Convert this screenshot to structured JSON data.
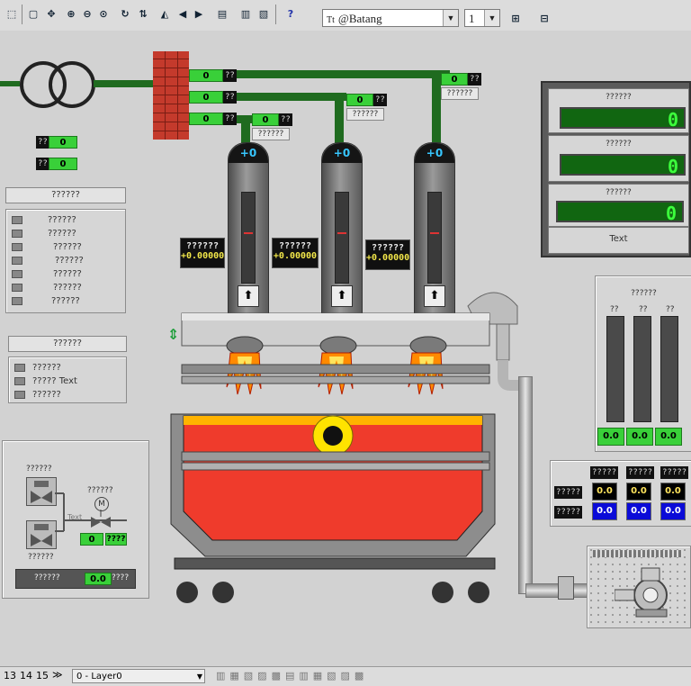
{
  "toolbar": {
    "font_name": "@Batang",
    "font_size": "1",
    "font_glyph": "Tt"
  },
  "transformer": {
    "label": ""
  },
  "pipes": {
    "top_values": [
      "0",
      "0",
      "0"
    ],
    "units": "??",
    "burner_values": [
      "0",
      "0",
      "0"
    ],
    "burner_labels": [
      "??????",
      "??????",
      "??????"
    ]
  },
  "left_small": [
    {
      "unit": "??",
      "value": "0"
    },
    {
      "unit": "??",
      "value": "0"
    }
  ],
  "list_panel": {
    "title": "??????",
    "items": [
      "??????",
      "??????",
      "??????",
      "??????",
      "??????",
      "??????",
      "??????"
    ]
  },
  "mode_panel": {
    "title": "??????",
    "items": [
      "??????",
      "?????  Text",
      "??????"
    ]
  },
  "burners": [
    {
      "top": "+0",
      "label": "??????",
      "value": "+0.00000"
    },
    {
      "top": "+0",
      "label": "??????",
      "value": "+0.00000"
    },
    {
      "top": "+0",
      "label": "??????",
      "value": "+0.00000"
    }
  ],
  "valve_panel": {
    "top_label": "??????",
    "mid_label": "??????",
    "motor": "M",
    "bottom_label": "??????",
    "text_label": "Text",
    "value": "0",
    "unit": "????",
    "footer_label": "??????",
    "footer_value": "0.0",
    "footer_unit": "????"
  },
  "lcd_panel": {
    "rows": [
      {
        "label": "??????",
        "value": "0"
      },
      {
        "label": "??????",
        "value": "0"
      },
      {
        "label": "??????",
        "value": "0"
      }
    ],
    "button": "Text"
  },
  "bars_panel": {
    "title": "??????",
    "cols": [
      "??",
      "??",
      "??"
    ],
    "values": [
      "0.0",
      "0.0",
      "0.0"
    ]
  },
  "grid_panel": {
    "headers": [
      "?????",
      "?????",
      "?????"
    ],
    "row_labels": [
      "?????",
      "?????"
    ],
    "yellow": [
      "0.0",
      "0.0",
      "0.0"
    ],
    "blue": [
      "0.0",
      "0.0",
      "0.0"
    ]
  },
  "status": {
    "pages": [
      "13",
      "14",
      "15"
    ],
    "more": "≫",
    "layer": "0 - Layer0"
  },
  "colors": {
    "pipe": "#1f6b1f",
    "value_green": "#39d039",
    "furnace": "#ef3b2c",
    "burner_text": "#37c7ff"
  }
}
